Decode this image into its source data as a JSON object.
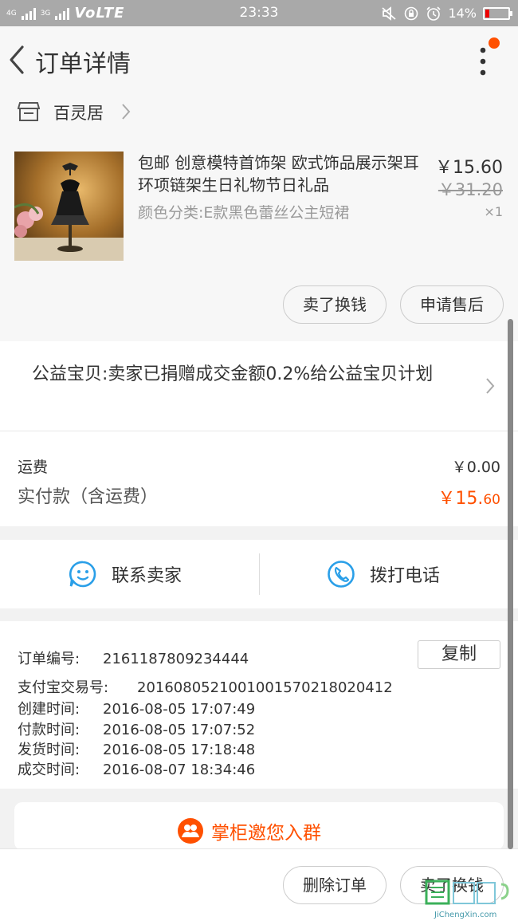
{
  "status_bar": {
    "network_small": "4G",
    "network_small2": "3G",
    "volte": "VoLTE",
    "time": "23:33",
    "battery": "14%"
  },
  "header": {
    "title": "订单详情"
  },
  "shop": {
    "name": "百灵居"
  },
  "product": {
    "title": "包邮 创意模特首饰架 欧式饰品展示架耳环项链架生日礼物节日礼品",
    "sku": "颜色分类:E款黑色蕾丝公主短裙",
    "price": "￥15.60",
    "original_price": "￥31.20",
    "quantity": "×1",
    "sell_button": "卖了换钱",
    "aftersale_button": "申请售后"
  },
  "charity": {
    "text": "公益宝贝:卖家已捐赠成交金额0.2%给公益宝贝计划"
  },
  "fees": {
    "shipping_label": "运费",
    "shipping_value": "￥0.00",
    "paid_label": "实付款（含运费）",
    "paid_value_main": "￥15.",
    "paid_value_decimal": "60"
  },
  "contact": {
    "seller_label": "联系卖家",
    "call_label": "拨打电话"
  },
  "order_info": {
    "order_no_label": "订单编号:",
    "order_no": "2161187809234444",
    "copy_button": "复制",
    "alipay_label": "支付宝交易号:",
    "alipay_no": "2016080521001001570218020412",
    "created_label": "创建时间:",
    "created": "2016-08-05 17:07:49",
    "paid_label": "付款时间:",
    "paid": "2016-08-05 17:07:52",
    "shipped_label": "发货时间:",
    "shipped": "2016-08-05 17:18:48",
    "done_label": "成交时间:",
    "done": "2016-08-07 18:34:46"
  },
  "group": {
    "label": "掌柜邀您入群"
  },
  "bottom_bar": {
    "delete_button": "删除订单",
    "sell_button": "卖了换钱"
  },
  "watermark": {
    "text": "JiChengXin.com"
  },
  "colors": {
    "accent": "#ff5000",
    "icon_blue": "#2a9fe8"
  }
}
